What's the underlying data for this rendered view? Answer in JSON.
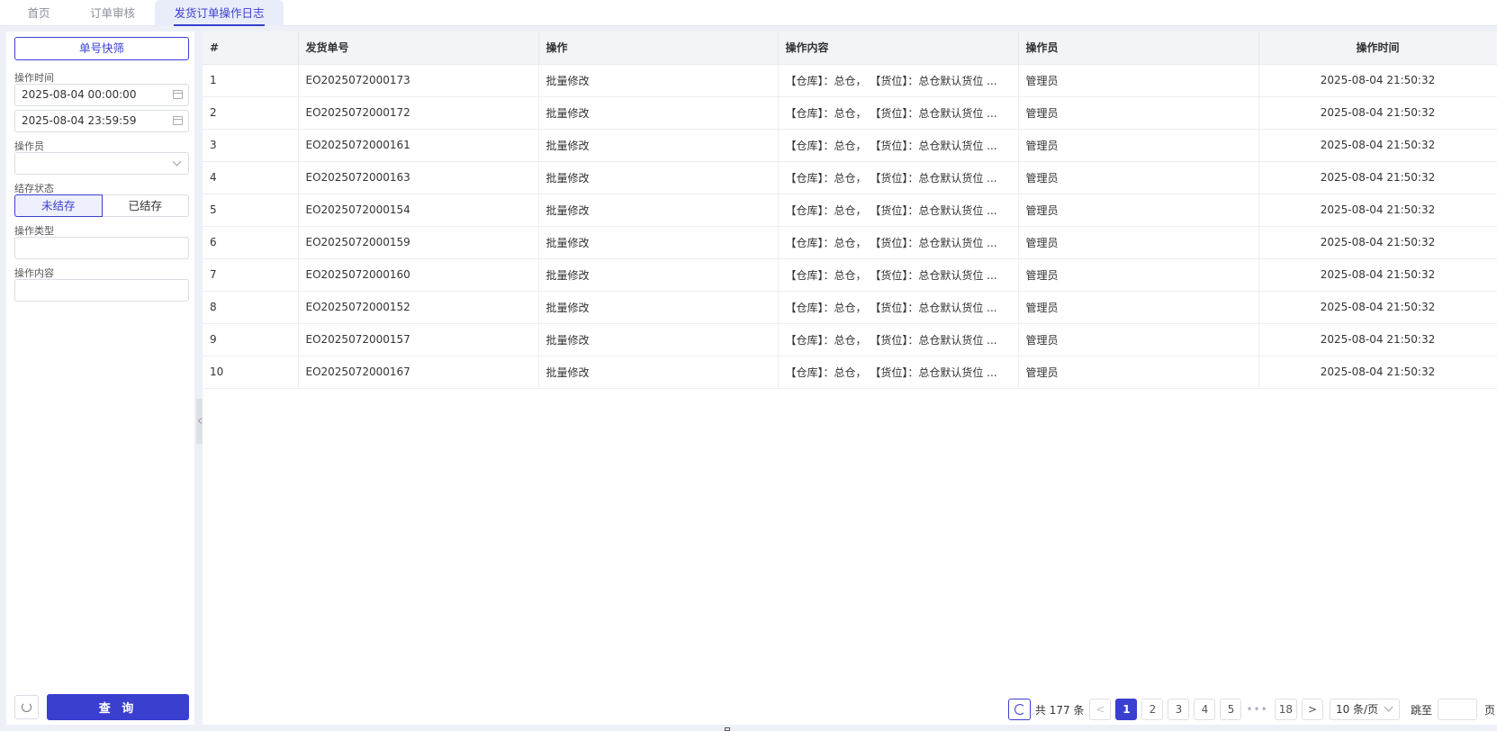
{
  "tabs": [
    {
      "label": "首页"
    },
    {
      "label": "订单审核"
    },
    {
      "label": "发货订单操作日志"
    }
  ],
  "sidebar": {
    "quick_filter_label": "单号快筛",
    "op_time_label": "操作时间",
    "start_time": "2025-08-04 00:00:00",
    "end_time": "2025-08-04 23:59:59",
    "operator_label": "操作员",
    "operator_value": "",
    "status_label": "结存状态",
    "status_options": [
      "未结存",
      "已结存"
    ],
    "op_type_label": "操作类型",
    "op_type_value": "",
    "op_content_label": "操作内容",
    "op_content_value": "",
    "query_label": "查 询"
  },
  "table": {
    "columns": [
      "#",
      "发货单号",
      "操作",
      "操作内容",
      "操作员",
      "操作时间"
    ],
    "rows": [
      {
        "idx": "1",
        "order_no": "EO2025072000173",
        "op": "批量修改",
        "content": "【仓库】：总仓， 【货位】：总仓默认货位 ...",
        "operator": "管理员",
        "time": "2025-08-04 21:50:32"
      },
      {
        "idx": "2",
        "order_no": "EO2025072000172",
        "op": "批量修改",
        "content": "【仓库】：总仓， 【货位】：总仓默认货位 ...",
        "operator": "管理员",
        "time": "2025-08-04 21:50:32"
      },
      {
        "idx": "3",
        "order_no": "EO2025072000161",
        "op": "批量修改",
        "content": "【仓库】：总仓， 【货位】：总仓默认货位 ...",
        "operator": "管理员",
        "time": "2025-08-04 21:50:32"
      },
      {
        "idx": "4",
        "order_no": "EO2025072000163",
        "op": "批量修改",
        "content": "【仓库】：总仓， 【货位】：总仓默认货位 ...",
        "operator": "管理员",
        "time": "2025-08-04 21:50:32"
      },
      {
        "idx": "5",
        "order_no": "EO2025072000154",
        "op": "批量修改",
        "content": "【仓库】：总仓， 【货位】：总仓默认货位 ...",
        "operator": "管理员",
        "time": "2025-08-04 21:50:32"
      },
      {
        "idx": "6",
        "order_no": "EO2025072000159",
        "op": "批量修改",
        "content": "【仓库】：总仓， 【货位】：总仓默认货位 ...",
        "operator": "管理员",
        "time": "2025-08-04 21:50:32"
      },
      {
        "idx": "7",
        "order_no": "EO2025072000160",
        "op": "批量修改",
        "content": "【仓库】：总仓， 【货位】：总仓默认货位 ...",
        "operator": "管理员",
        "time": "2025-08-04 21:50:32"
      },
      {
        "idx": "8",
        "order_no": "EO2025072000152",
        "op": "批量修改",
        "content": "【仓库】：总仓， 【货位】：总仓默认货位 ...",
        "operator": "管理员",
        "time": "2025-08-04 21:50:32"
      },
      {
        "idx": "9",
        "order_no": "EO2025072000157",
        "op": "批量修改",
        "content": "【仓库】：总仓， 【货位】：总仓默认货位 ...",
        "operator": "管理员",
        "time": "2025-08-04 21:50:32"
      },
      {
        "idx": "10",
        "order_no": "EO2025072000167",
        "op": "批量修改",
        "content": "【仓库】：总仓， 【货位】：总仓默认货位 ...",
        "operator": "管理员",
        "time": "2025-08-04 21:50:32"
      }
    ]
  },
  "pagination": {
    "total_text": "共 177 条",
    "prev": "<",
    "pages": [
      "1",
      "2",
      "3",
      "4",
      "5"
    ],
    "ellipsis": "•••",
    "last_page": "18",
    "next": ">",
    "page_size": "10 条/页",
    "jump_label": "跳至",
    "page_unit": "页"
  },
  "colors": {
    "accent": "#3a3fd0"
  }
}
